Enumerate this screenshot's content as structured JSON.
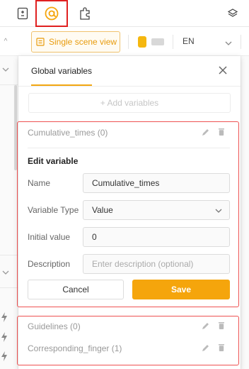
{
  "colors": {
    "accent": "#f5a50c",
    "highlight_border": "#ee5252"
  },
  "toolbar": {
    "icons": [
      "insert-icon",
      "variables-icon",
      "plugin-icon",
      "layers-icon"
    ]
  },
  "scene": {
    "view_label": "Single scene view",
    "language": "EN"
  },
  "panel": {
    "title": "Global variables",
    "add_label": "+ Add variables",
    "expanded_item": {
      "title": "Cumulative_times (0)",
      "edit_title": "Edit variable",
      "fields": {
        "name_label": "Name",
        "name_value": "Cumulative_times",
        "type_label": "Variable Type",
        "type_value": "Value",
        "initial_label": "Initial value",
        "initial_value": "0",
        "desc_label": "Description",
        "desc_placeholder": "Enter description (optional)"
      },
      "cancel_label": "Cancel",
      "save_label": "Save"
    },
    "other_items": [
      {
        "title": "Guidelines (0)"
      },
      {
        "title": "Corresponding_finger (1)"
      }
    ]
  }
}
